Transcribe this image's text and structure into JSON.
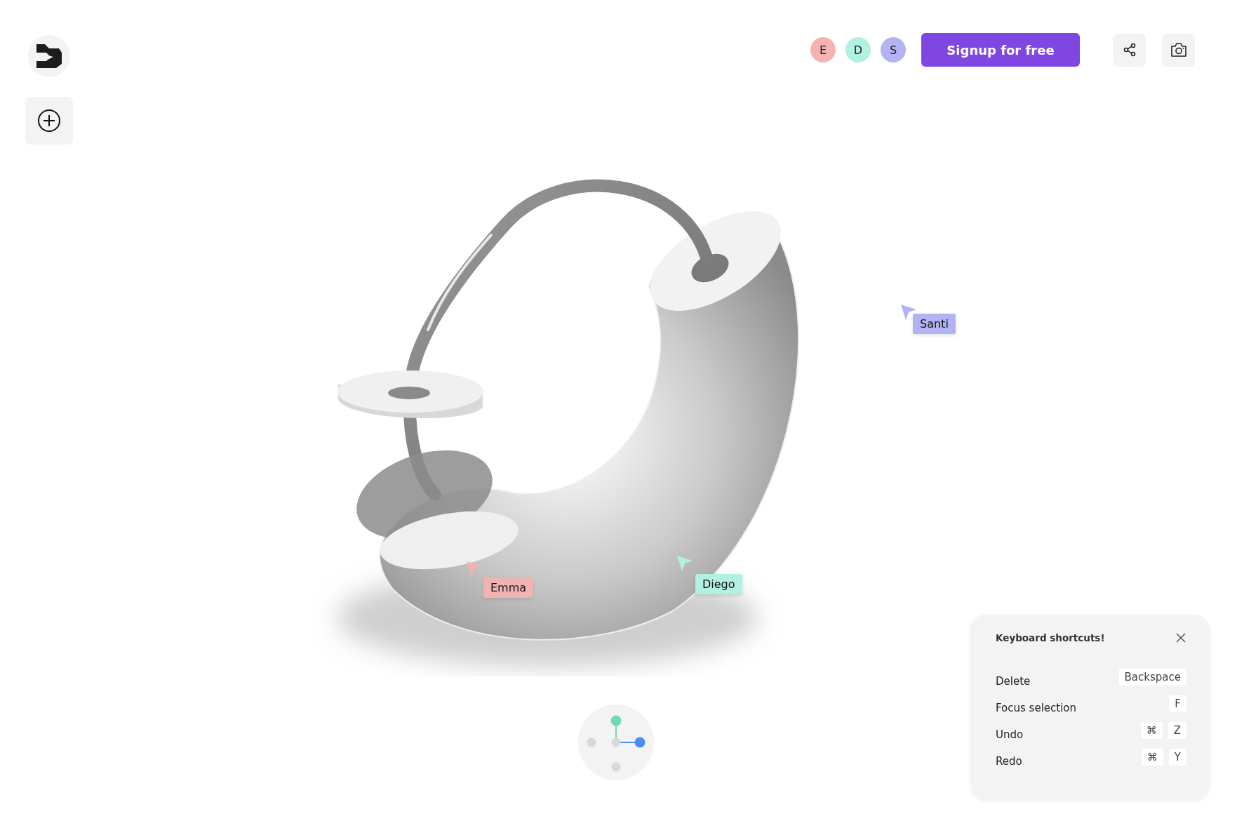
{
  "avatars": [
    {
      "initial": "E",
      "color": "#f4b3b1"
    },
    {
      "initial": "D",
      "color": "#b2f0e2"
    },
    {
      "initial": "S",
      "color": "#b3b3f3"
    }
  ],
  "signup_button": {
    "label": "Signup for free"
  },
  "cursors": [
    {
      "name": "Santi",
      "color": "#b3b3f3"
    },
    {
      "name": "Emma",
      "color": "#f4b3b1"
    },
    {
      "name": "Diego",
      "color": "#b2f0e2"
    }
  ],
  "shortcuts_panel": {
    "title": "Keyboard shortcuts!",
    "rows": [
      {
        "label": "Delete",
        "keys": [
          "Backspace"
        ]
      },
      {
        "label": "Focus selection",
        "keys": [
          "F"
        ]
      },
      {
        "label": "Undo",
        "keys": [
          "⌘",
          "Z"
        ]
      },
      {
        "label": "Redo",
        "keys": [
          "⌘",
          "Y"
        ]
      }
    ]
  }
}
